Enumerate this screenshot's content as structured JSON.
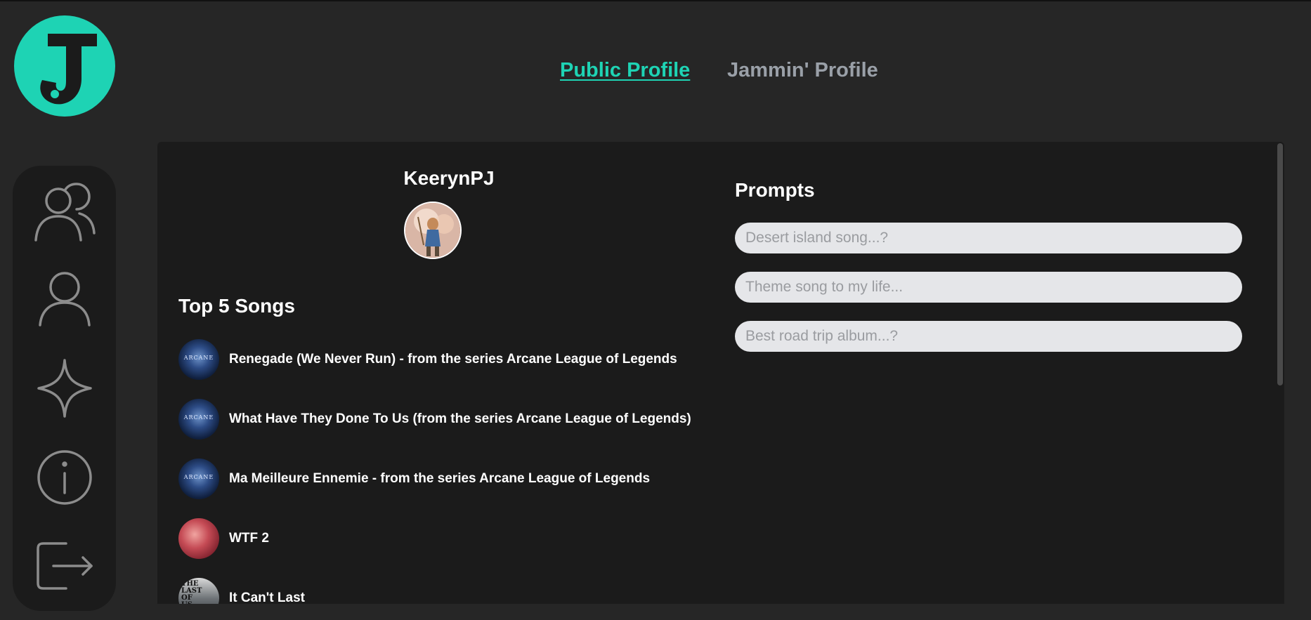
{
  "app": {
    "logo_letter": "J",
    "accent_color": "#1ed3b4"
  },
  "tabs": [
    {
      "label": "Public Profile",
      "active": true
    },
    {
      "label": "Jammin' Profile",
      "active": false
    }
  ],
  "sidebar": {
    "items": [
      {
        "icon": "users-icon",
        "label": ""
      },
      {
        "icon": "user-icon",
        "label": ""
      },
      {
        "icon": "sparkle-icon",
        "label": ""
      },
      {
        "icon": "info-icon",
        "label": ""
      },
      {
        "icon": "logout-icon",
        "label": ""
      }
    ]
  },
  "profile": {
    "username": "KeerynPJ",
    "top_songs_title": "Top 5 Songs",
    "songs": [
      {
        "title": "Renegade (We Never Run) - from the series Arcane League of Legends",
        "art": "ARCANE"
      },
      {
        "title": "What Have They Done To Us (from the series Arcane League of Legends)",
        "art": "ARCANE"
      },
      {
        "title": "Ma Meilleure Ennemie - from the series Arcane League of Legends",
        "art": "ARCANE"
      },
      {
        "title": "WTF 2",
        "art": ""
      },
      {
        "title": "It Can't Last",
        "art": "THE LAST OF US"
      }
    ]
  },
  "prompts": {
    "title": "Prompts",
    "fields": [
      {
        "placeholder": "Desert island song...?",
        "value": ""
      },
      {
        "placeholder": "Theme song to my life...",
        "value": ""
      },
      {
        "placeholder": "Best road trip album...?",
        "value": ""
      }
    ]
  }
}
